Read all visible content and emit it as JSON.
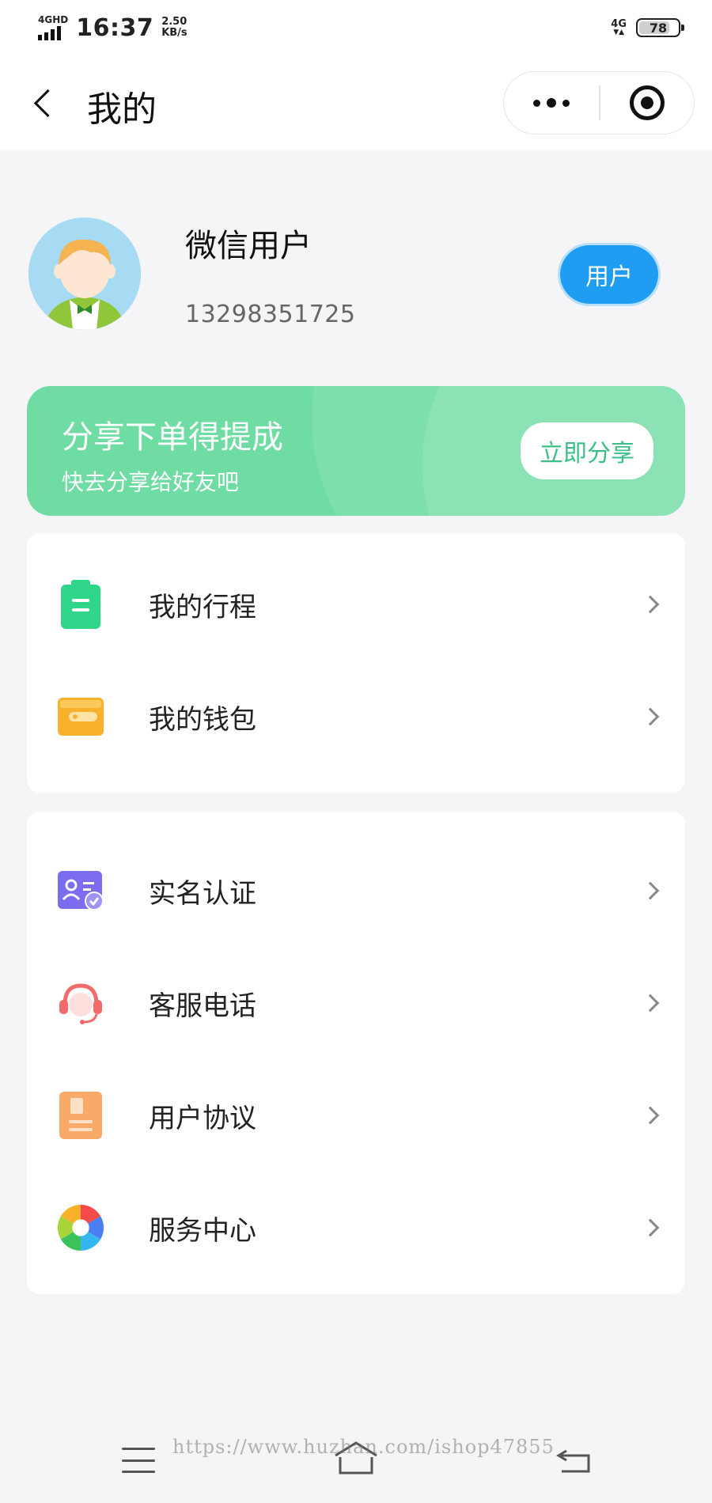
{
  "status_bar": {
    "network_label": "4GHD",
    "time": "16:37",
    "speed_value": "2.50",
    "speed_unit": "KB/s",
    "network_right": "4G",
    "battery": "78"
  },
  "nav": {
    "title": "我的"
  },
  "profile": {
    "name": "微信用户",
    "phone": "13298351725",
    "role_button": "用户"
  },
  "share_banner": {
    "title": "分享下单得提成",
    "subtitle": "快去分享给好友吧",
    "button": "立即分享",
    "colors": {
      "background": "#6fdca4",
      "button_text": "#3cc088"
    }
  },
  "menu_group_1": [
    {
      "label": "我的行程",
      "icon": "clipboard-icon"
    },
    {
      "label": "我的钱包",
      "icon": "wallet-icon"
    }
  ],
  "menu_group_2": [
    {
      "label": "实名认证",
      "icon": "id-verify-icon"
    },
    {
      "label": "客服电话",
      "icon": "headset-icon"
    },
    {
      "label": "用户协议",
      "icon": "document-icon"
    },
    {
      "label": "服务中心",
      "icon": "aperture-icon"
    }
  ],
  "watermark": "https://www.huzhan.com/ishop47855",
  "colors": {
    "accent_blue": "#1e9df3",
    "page_bg": "#f5f5f7"
  }
}
